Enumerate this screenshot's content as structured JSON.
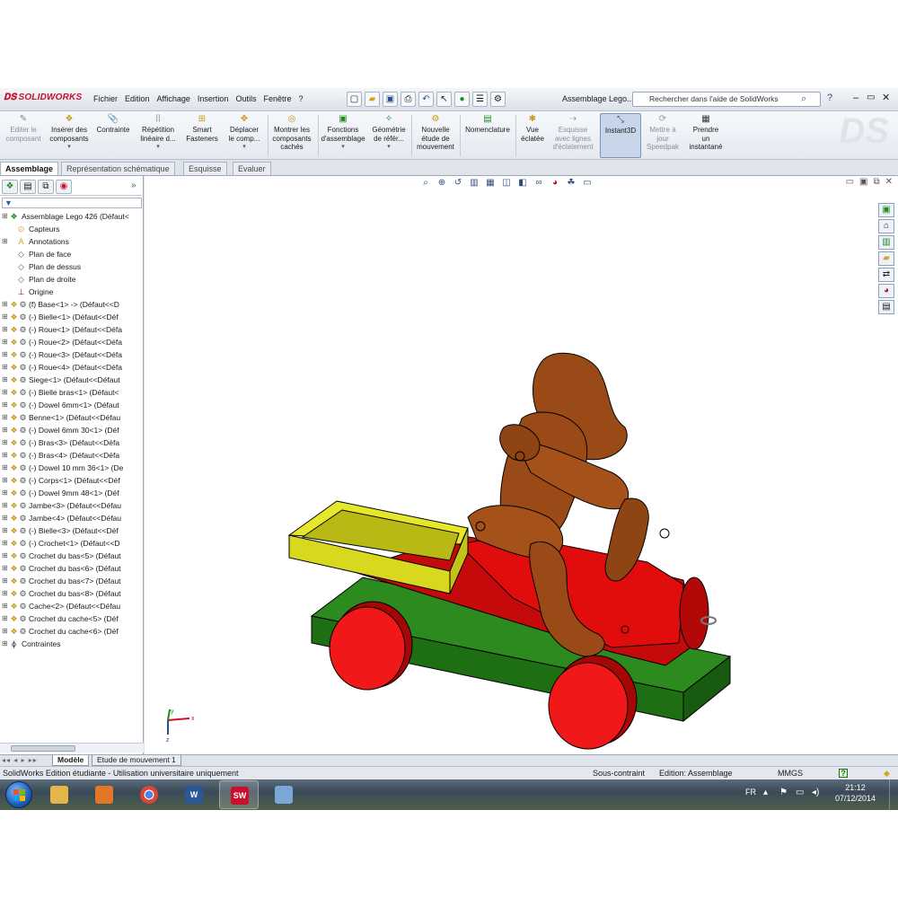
{
  "app": {
    "logo_text": "SOLIDWORKS",
    "document_title": "Assemblage Lego..."
  },
  "menu": [
    "Fichier",
    "Edition",
    "Affichage",
    "Insertion",
    "Outils",
    "Fenêtre",
    "?"
  ],
  "search": {
    "placeholder": "Rechercher dans l'aide de SolidWorks"
  },
  "commands": [
    {
      "label1": "Editer le",
      "label2": "composant",
      "label3": "",
      "icon": "edit-component-icon",
      "disabled": true
    },
    {
      "label1": "Insérer des",
      "label2": "composants",
      "label3": "",
      "icon": "insert-components-icon",
      "disabled": false
    },
    {
      "label1": "Contrainte",
      "label2": "",
      "label3": "",
      "icon": "mate-icon",
      "disabled": false
    },
    {
      "label1": "Répétition",
      "label2": "linéaire d...",
      "label3": "",
      "icon": "linear-pattern-icon",
      "disabled": false
    },
    {
      "label1": "Smart",
      "label2": "Fasteners",
      "label3": "",
      "icon": "smart-fasteners-icon",
      "disabled": false
    },
    {
      "label1": "Déplacer",
      "label2": "le comp...",
      "label3": "",
      "icon": "move-component-icon",
      "disabled": false
    },
    {
      "label1": "Montrer les",
      "label2": "composants",
      "label3": "cachés",
      "icon": "show-hidden-icon",
      "disabled": false
    },
    {
      "label1": "Fonctions",
      "label2": "d'assemblage",
      "label3": "",
      "icon": "assembly-features-icon",
      "disabled": false
    },
    {
      "label1": "Géométrie",
      "label2": "de référ...",
      "label3": "",
      "icon": "reference-geometry-icon",
      "disabled": false
    },
    {
      "label1": "Nouvelle",
      "label2": "étude de",
      "label3": "mouvement",
      "icon": "motion-study-icon",
      "disabled": false
    },
    {
      "label1": "Nomenclature",
      "label2": "",
      "label3": "",
      "icon": "bom-icon",
      "disabled": false
    },
    {
      "label1": "Vue",
      "label2": "éclatée",
      "label3": "",
      "icon": "exploded-view-icon",
      "disabled": false
    },
    {
      "label1": "Esquisse",
      "label2": "avec lignes",
      "label3": "d'éclatement",
      "icon": "explode-line-sketch-icon",
      "disabled": true
    },
    {
      "label1": "Instant3D",
      "label2": "",
      "label3": "",
      "icon": "instant3d-icon",
      "disabled": false
    },
    {
      "label1": "Mettre à",
      "label2": "jour",
      "label3": "Speedpak",
      "icon": "speedpak-icon",
      "disabled": true
    },
    {
      "label1": "Prendre",
      "label2": "un",
      "label3": "instantané",
      "icon": "snapshot-icon",
      "disabled": false
    }
  ],
  "tabs": [
    "Assemblage",
    "Représentation schématique",
    "Esquisse",
    "Evaluer"
  ],
  "tree": {
    "filter_glyph": "▼",
    "root": "Assemblage Lego 426  (Défaut<",
    "items": [
      {
        "label": "Capteurs",
        "icon": "sensor-icon",
        "indent": 1,
        "expandable": false
      },
      {
        "label": "Annotations",
        "icon": "annotations-icon",
        "indent": 1,
        "expandable": true
      },
      {
        "label": "Plan de face",
        "icon": "plane-icon",
        "indent": 1,
        "expandable": false
      },
      {
        "label": "Plan de dessus",
        "icon": "plane-icon",
        "indent": 1,
        "expandable": false
      },
      {
        "label": "Plan de droite",
        "icon": "plane-icon",
        "indent": 1,
        "expandable": false
      },
      {
        "label": "Origine",
        "icon": "origin-icon",
        "indent": 1,
        "expandable": false
      },
      {
        "label": "(f) Base<1> -> (Défaut<<D",
        "icon": "part-icon",
        "indent": 0,
        "expandable": true
      },
      {
        "label": "(-) Bielle<1> (Défaut<<Déf",
        "icon": "part-icon",
        "indent": 0,
        "expandable": true
      },
      {
        "label": "(-) Roue<1> (Défaut<<Défa",
        "icon": "part-icon",
        "indent": 0,
        "expandable": true
      },
      {
        "label": "(-) Roue<2> (Défaut<<Défa",
        "icon": "part-icon",
        "indent": 0,
        "expandable": true
      },
      {
        "label": "(-) Roue<3> (Défaut<<Défa",
        "icon": "part-icon",
        "indent": 0,
        "expandable": true
      },
      {
        "label": "(-) Roue<4> (Défaut<<Défa",
        "icon": "part-icon",
        "indent": 0,
        "expandable": true
      },
      {
        "label": "Siege<1> (Défaut<<Défaut",
        "icon": "part-icon",
        "indent": 0,
        "expandable": true
      },
      {
        "label": "(-) Bielle bras<1> (Défaut<",
        "icon": "part-icon",
        "indent": 0,
        "expandable": true
      },
      {
        "label": "(-) Dowel 6mm<1> (Défaut",
        "icon": "part-icon",
        "indent": 0,
        "expandable": true
      },
      {
        "label": "Benne<1> (Défaut<<Défau",
        "icon": "part-icon",
        "indent": 0,
        "expandable": true
      },
      {
        "label": "(-) Dowel 6mm 30<1> (Déf",
        "icon": "part-icon",
        "indent": 0,
        "expandable": true
      },
      {
        "label": "(-) Bras<3> (Défaut<<Défa",
        "icon": "part-icon",
        "indent": 0,
        "expandable": true
      },
      {
        "label": "(-) Bras<4> (Défaut<<Défa",
        "icon": "part-icon",
        "indent": 0,
        "expandable": true
      },
      {
        "label": "(-) Dowel 10 mm 36<1> (De",
        "icon": "part-icon",
        "indent": 0,
        "expandable": true
      },
      {
        "label": "(-) Corps<1> (Défaut<<Déf",
        "icon": "part-icon",
        "indent": 0,
        "expandable": true
      },
      {
        "label": "(-) Dowel 9mm 48<1> (Déf",
        "icon": "part-icon",
        "indent": 0,
        "expandable": true
      },
      {
        "label": "Jambe<3> (Défaut<<Défau",
        "icon": "part-icon",
        "indent": 0,
        "expandable": true
      },
      {
        "label": "Jambe<4> (Défaut<<Défau",
        "icon": "part-icon",
        "indent": 0,
        "expandable": true
      },
      {
        "label": "(-) Bielle<3> (Défaut<<Déf",
        "icon": "part-icon",
        "indent": 0,
        "expandable": true
      },
      {
        "label": "(-) Crochet<1> (Défaut<<D",
        "icon": "part-icon",
        "indent": 0,
        "expandable": true
      },
      {
        "label": "Crochet du bas<5> (Défaut",
        "icon": "part-icon",
        "indent": 0,
        "expandable": true
      },
      {
        "label": "Crochet du bas<6> (Défaut",
        "icon": "part-icon",
        "indent": 0,
        "expandable": true
      },
      {
        "label": "Crochet du bas<7> (Défaut",
        "icon": "part-icon",
        "indent": 0,
        "expandable": true
      },
      {
        "label": "Crochet du bas<8> (Défaut",
        "icon": "part-icon",
        "indent": 0,
        "expandable": true
      },
      {
        "label": "Cache<2> (Défaut<<Défau",
        "icon": "part-icon",
        "indent": 0,
        "expandable": true
      },
      {
        "label": "Crochet du cache<5> (Déf",
        "icon": "part-icon",
        "indent": 0,
        "expandable": true
      },
      {
        "label": "Crochet du cache<6> (Déf",
        "icon": "part-icon",
        "indent": 0,
        "expandable": true
      },
      {
        "label": "Contraintes",
        "icon": "mates-folder-icon",
        "indent": 0,
        "expandable": true
      }
    ]
  },
  "model_tabs": [
    "Modèle",
    "Etude de mouvement 1"
  ],
  "status": {
    "left": "SolidWorks Edition étudiante - Utilisation universitaire uniquement",
    "constraint": "Sous-contraint",
    "mode": "Edition: Assemblage",
    "units": "MMGS",
    "help": "?"
  },
  "taskbar": {
    "apps": [
      {
        "name": "explorer",
        "icon": "folder-icon",
        "color": "#e3b54a",
        "text": ""
      },
      {
        "name": "media-player",
        "icon": "media-player-icon",
        "color": "#e2772a",
        "text": ""
      },
      {
        "name": "chrome",
        "icon": "chrome-icon",
        "color": "#3a8d3a",
        "text": ""
      },
      {
        "name": "word",
        "icon": "word-icon",
        "color": "#2b5797",
        "text": "W"
      },
      {
        "name": "solidworks",
        "icon": "solidworks-icon",
        "color": "#c8102e",
        "text": "SW"
      },
      {
        "name": "paint",
        "icon": "paint-icon",
        "color": "#7aa6d8",
        "text": ""
      }
    ],
    "language": "FR",
    "time": "21:12",
    "date": "07/12/2014"
  },
  "colors": {
    "body_red": "#e10d0d",
    "base_green": "#1e6e14",
    "bucket_yellow": "#d8d81e",
    "figure_brown": "#9a4a17",
    "wheel_red": "#f01818"
  },
  "triad_labels": {
    "x": "x",
    "y": "y",
    "z": "z"
  }
}
